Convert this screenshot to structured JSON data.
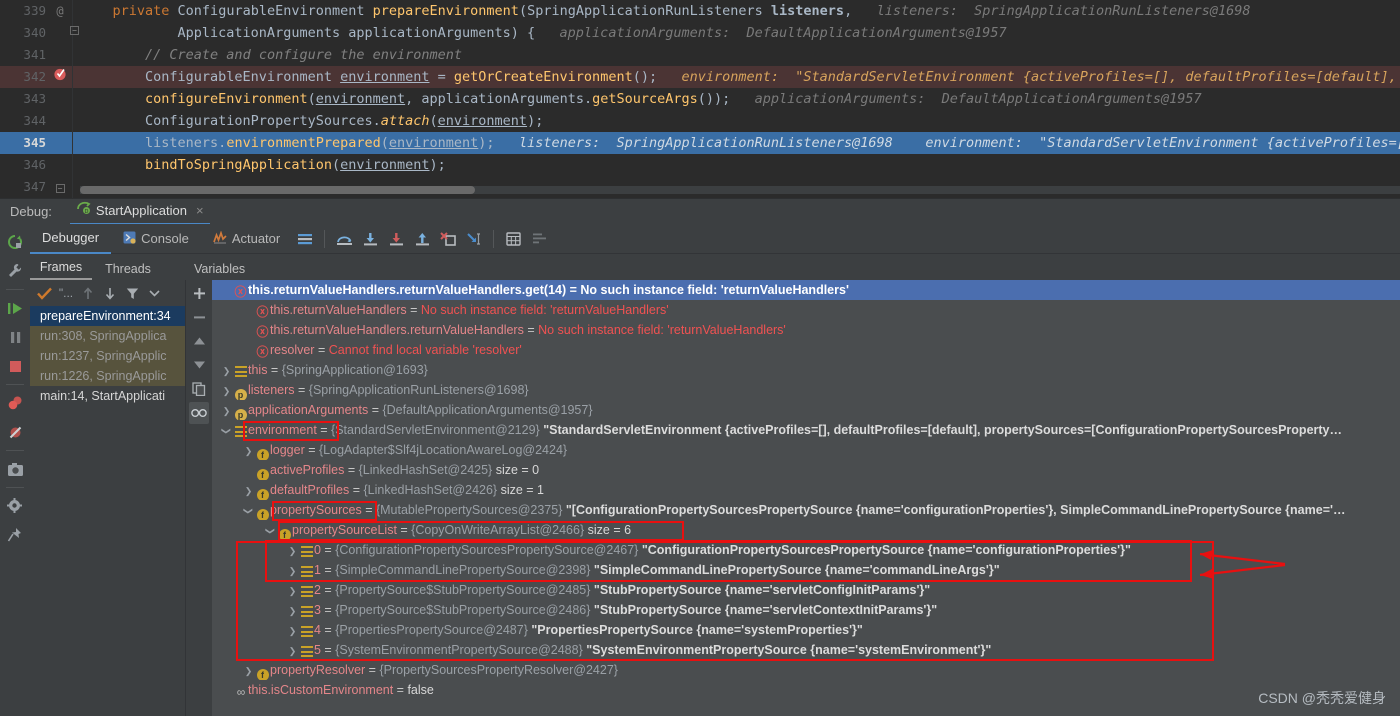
{
  "editor": {
    "lines": [
      {
        "num": "339",
        "gutter": "@",
        "html": "    <span class='kw'>private</span> ConfigurableEnvironment <span class='mth'>prepareEnvironment</span>(SpringApplicationRunListeners <span style='font-weight:bold'>listeners</span>,   <span class='hint'>listeners:  SpringApplicationRunListeners@1698</span>",
        "state": ""
      },
      {
        "num": "340",
        "gutter": "",
        "html": "            ApplicationArguments applicationArguments) {   <span class='hint'>applicationArguments:  DefaultApplicationArguments@1957</span>",
        "state": ""
      },
      {
        "num": "341",
        "gutter": "",
        "html": "        <span class='cmt'>// Create and configure the environment</span>",
        "state": ""
      },
      {
        "num": "342",
        "gutter": "bp",
        "html": "        ConfigurableEnvironment <span class='und'>environment</span> = <span class='mth'>getOrCreateEnvironment</span>();   <span class='hint-o'>environment:  \"StandardServletEnvironment {activeProfiles=[], defaultProfiles=[default], property</span>",
        "state": "bp"
      },
      {
        "num": "343",
        "gutter": "",
        "html": "        <span class='mth'>configureEnvironment</span>(<span class='und'>environment</span>, applicationArguments.<span class='mth'>getSourceArgs</span>());   <span class='hint'>applicationArguments:  DefaultApplicationArguments@1957</span>",
        "state": ""
      },
      {
        "num": "344",
        "gutter": "",
        "html": "        ConfigurationPropertySources.<span class='mth itl'>attach</span>(<span class='und'>environment</span>);",
        "state": ""
      },
      {
        "num": "345",
        "gutter": "",
        "html": "        listeners.<span class='mth'>environmentPrepared</span>(<span class='und'>environment</span>);   <span class='hint-w'>listeners:  SpringApplicationRunListeners@1698</span>    <span class='hint-w'>environment:  \"StandardServletEnvironment {activeProfiles=[], defaul</span>",
        "state": "cur"
      },
      {
        "num": "346",
        "gutter": "",
        "html": "        <span class='mth'>bindToSpringApplication</span>(<span class='und'>environment</span>);",
        "state": ""
      },
      {
        "num": "347",
        "gutter": "fold",
        "html": "",
        "state": ""
      }
    ]
  },
  "debug_window": {
    "label": "Debug:",
    "tab_title": "StartApplication",
    "tab_close": "×"
  },
  "view_tabs": [
    {
      "label": "Debugger",
      "icon": "debugger-icon",
      "active": true
    },
    {
      "label": "Console",
      "icon": "console-icon",
      "active": false
    },
    {
      "label": "Actuator",
      "icon": "actuator-icon",
      "active": false
    }
  ],
  "sub_tabs": {
    "frames": "Frames",
    "threads": "Threads",
    "variables": "Variables"
  },
  "frames": [
    {
      "label": "prepareEnvironment:34",
      "style": "sel"
    },
    {
      "label": "run:308, SpringApplica",
      "style": "lib"
    },
    {
      "label": "run:1237, SpringApplic",
      "style": "lib"
    },
    {
      "label": "run:1226, SpringApplic",
      "style": "lib"
    },
    {
      "label": "main:14, StartApplicati",
      "style": ""
    }
  ],
  "variables": [
    {
      "indent": 0,
      "arrow": "none",
      "icon": "error",
      "selected": true,
      "name": "this.returnValueHandlers.returnValueHandlers.get(14)",
      "eq": " = ",
      "value": "No such instance field: 'returnValueHandlers'",
      "value_kind": "err"
    },
    {
      "indent": 1,
      "arrow": "none",
      "icon": "error",
      "selected": false,
      "name": "this.returnValueHandlers",
      "eq": " = ",
      "value": "No such instance field: 'returnValueHandlers'",
      "value_kind": "err"
    },
    {
      "indent": 1,
      "arrow": "none",
      "icon": "error",
      "selected": false,
      "name": "this.returnValueHandlers.returnValueHandlers",
      "eq": " = ",
      "value": "No such instance field: 'returnValueHandlers'",
      "value_kind": "err"
    },
    {
      "indent": 1,
      "arrow": "none",
      "icon": "error",
      "selected": false,
      "name": "resolver",
      "eq": " = ",
      "value": "Cannot find local variable 'resolver'",
      "value_kind": "err"
    },
    {
      "indent": 0,
      "arrow": "collapsed",
      "icon": "stack",
      "selected": false,
      "name": "this",
      "eq": " = ",
      "ref": "{SpringApplication@1693}",
      "value": "",
      "value_kind": "none"
    },
    {
      "indent": 0,
      "arrow": "collapsed",
      "icon": "param",
      "selected": false,
      "name": "listeners",
      "eq": " = ",
      "ref": "{SpringApplicationRunListeners@1698}",
      "value": "",
      "value_kind": "none"
    },
    {
      "indent": 0,
      "arrow": "collapsed",
      "icon": "param",
      "selected": false,
      "name": "applicationArguments",
      "eq": " = ",
      "ref": "{DefaultApplicationArguments@1957}",
      "value": "",
      "value_kind": "none"
    },
    {
      "indent": 0,
      "arrow": "expanded",
      "icon": "stack",
      "selected": false,
      "name": "environment",
      "eq": " = ",
      "ref": "{StandardServletEnvironment@2129}",
      "value": "\"StandardServletEnvironment {activeProfiles=[], defaultProfiles=[default], propertySources=[ConfigurationPropertySourcesProperty…",
      "value_kind": "str"
    },
    {
      "indent": 1,
      "arrow": "collapsed",
      "icon": "field",
      "selected": false,
      "name": "logger",
      "eq": " = ",
      "ref": "{LogAdapter$Slf4jLocationAwareLog@2424}",
      "value": "",
      "value_kind": "none"
    },
    {
      "indent": 1,
      "arrow": "none",
      "icon": "field",
      "selected": false,
      "name": "activeProfiles",
      "eq": " = ",
      "ref": "{LinkedHashSet@2425}",
      "value": "size = 0",
      "value_kind": "size"
    },
    {
      "indent": 1,
      "arrow": "collapsed",
      "icon": "field",
      "selected": false,
      "name": "defaultProfiles",
      "eq": " = ",
      "ref": "{LinkedHashSet@2426}",
      "value": "size = 1",
      "value_kind": "size"
    },
    {
      "indent": 1,
      "arrow": "expanded",
      "icon": "field",
      "selected": false,
      "name": "propertySources",
      "eq": " = ",
      "ref": "{MutablePropertySources@2375}",
      "value": "\"[ConfigurationPropertySourcesPropertySource {name='configurationProperties'}, SimpleCommandLinePropertySource {name='…",
      "value_kind": "str"
    },
    {
      "indent": 2,
      "arrow": "expanded",
      "icon": "field",
      "selected": false,
      "name": "propertySourceList",
      "eq": " = ",
      "ref": "{CopyOnWriteArrayList@2466}",
      "value": "size = 6",
      "value_kind": "size"
    },
    {
      "indent": 3,
      "arrow": "collapsed",
      "icon": "stack",
      "selected": false,
      "name": "0",
      "eq": " = ",
      "ref": "{ConfigurationPropertySourcesPropertySource@2467}",
      "value": "\"ConfigurationPropertySourcesPropertySource {name='configurationProperties'}\"",
      "value_kind": "str"
    },
    {
      "indent": 3,
      "arrow": "collapsed",
      "icon": "stack",
      "selected": false,
      "name": "1",
      "eq": " = ",
      "ref": "{SimpleCommandLinePropertySource@2398}",
      "value": "\"SimpleCommandLinePropertySource {name='commandLineArgs'}\"",
      "value_kind": "str"
    },
    {
      "indent": 3,
      "arrow": "collapsed",
      "icon": "stack",
      "selected": false,
      "name": "2",
      "eq": " = ",
      "ref": "{PropertySource$StubPropertySource@2485}",
      "value": "\"StubPropertySource {name='servletConfigInitParams'}\"",
      "value_kind": "str"
    },
    {
      "indent": 3,
      "arrow": "collapsed",
      "icon": "stack",
      "selected": false,
      "name": "3",
      "eq": " = ",
      "ref": "{PropertySource$StubPropertySource@2486}",
      "value": "\"StubPropertySource {name='servletContextInitParams'}\"",
      "value_kind": "str"
    },
    {
      "indent": 3,
      "arrow": "collapsed",
      "icon": "stack",
      "selected": false,
      "name": "4",
      "eq": " = ",
      "ref": "{PropertiesPropertySource@2487}",
      "value": "\"PropertiesPropertySource {name='systemProperties'}\"",
      "value_kind": "str"
    },
    {
      "indent": 3,
      "arrow": "collapsed",
      "icon": "stack",
      "selected": false,
      "name": "5",
      "eq": " = ",
      "ref": "{SystemEnvironmentPropertySource@2488}",
      "value": "\"SystemEnvironmentPropertySource {name='systemEnvironment'}\"",
      "value_kind": "str"
    },
    {
      "indent": 1,
      "arrow": "collapsed",
      "icon": "field",
      "selected": false,
      "name": "propertyResolver",
      "eq": " = ",
      "ref": "{PropertySourcesPropertyResolver@2427}",
      "value": "",
      "value_kind": "none"
    },
    {
      "indent": 0,
      "arrow": "none",
      "icon": "eye",
      "selected": false,
      "name": "this.isCustomEnvironment",
      "eq": " = ",
      "ref": "",
      "value": "false",
      "value_kind": "bool"
    }
  ],
  "watermark": "CSDN @秃秃爱健身",
  "colors": {
    "accent_blue": "#4b6eaf",
    "annotation_red": "#e81010",
    "error_red": "#f05252",
    "editor_bg": "#2b2b2b",
    "panel_bg": "#3c3f41",
    "vars_bg": "#4a4d4f",
    "current_line": "#3a6ea5",
    "breakpoint_line": "#4b3434"
  }
}
